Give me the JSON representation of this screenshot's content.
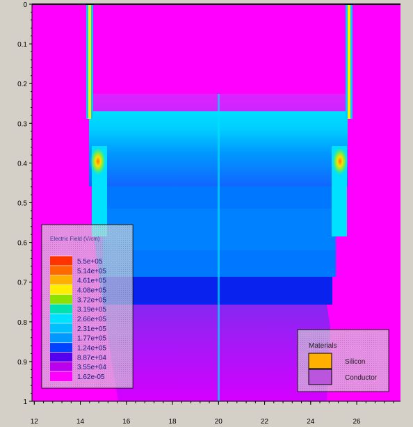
{
  "chart_data": {
    "type": "heatmap",
    "title": "",
    "xlabel": "",
    "ylabel": "",
    "xlim": [
      11.9,
      27.9
    ],
    "ylim": [
      0,
      1
    ],
    "y_axis_inverted": true,
    "x_ticks": [
      "12",
      "14",
      "16",
      "18",
      "20",
      "22",
      "24",
      "26"
    ],
    "y_ticks": [
      "0",
      "0.1",
      "0.2",
      "0.3",
      "0.4",
      "0.5",
      "0.6",
      "0.7",
      "0.8",
      "0.9",
      "1"
    ],
    "grid": false,
    "colormap_legend": {
      "title": "Electric Field (V/cm)",
      "placement": "bottom-left",
      "entries": [
        {
          "label": "5.5e+05",
          "color": "#ff3300"
        },
        {
          "label": "5.14e+05",
          "color": "#ff6a00"
        },
        {
          "label": "4.61e+05",
          "color": "#ffb000"
        },
        {
          "label": "4.08e+05",
          "color": "#ffee00"
        },
        {
          "label": "3.72e+05",
          "color": "#8ee000"
        },
        {
          "label": "3.19e+05",
          "color": "#00e0b0"
        },
        {
          "label": "2.66e+05",
          "color": "#00e0ff"
        },
        {
          "label": "2.31e+05",
          "color": "#00bfff"
        },
        {
          "label": "1.77e+05",
          "color": "#0099ff"
        },
        {
          "label": "1.24e+05",
          "color": "#0044ff"
        },
        {
          "label": "8.87e+04",
          "color": "#5500ee"
        },
        {
          "label": "3.55e+04",
          "color": "#bb00ee"
        },
        {
          "label": "1.62e-05",
          "color": "#ff00ff"
        }
      ]
    },
    "materials_legend": {
      "title": "Materials",
      "placement": "bottom-right",
      "entries": [
        {
          "label": "Silicon",
          "color": "#ffb000"
        },
        {
          "label": "Conductor",
          "color": "#bb55dd"
        }
      ]
    }
  }
}
